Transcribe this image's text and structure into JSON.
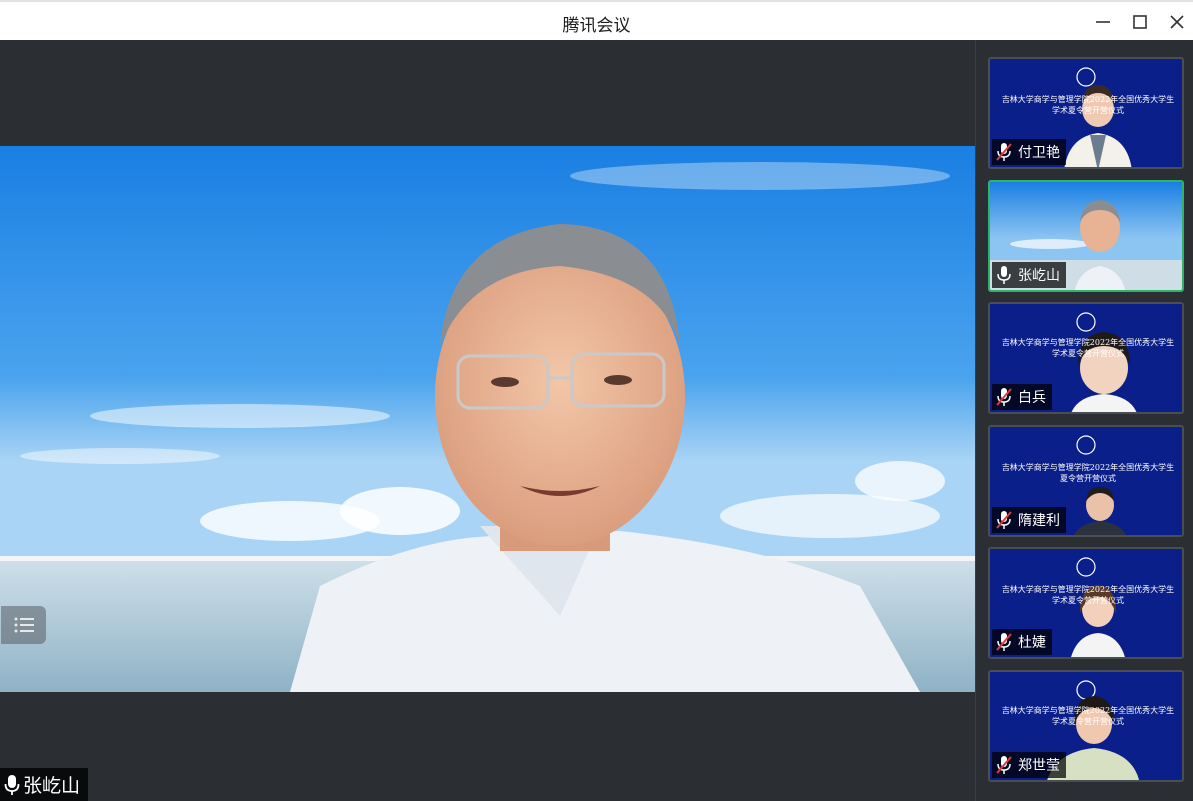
{
  "window": {
    "title": "腾讯会议",
    "minimize_icon": "minimize-icon",
    "maximize_icon": "maximize-icon",
    "close_icon": "close-icon"
  },
  "main_speaker": {
    "name": "张屹山",
    "mic_icon": "microphone-icon",
    "list_toggle_icon": "list-icon"
  },
  "banner": {
    "line1": "吉林大学商学与管理学院2022年全国优秀大学生",
    "line2": "学术夏令营开营仪式",
    "line2_alt": "夏令营开营仪式"
  },
  "participants": [
    {
      "name": "付卫艳",
      "mic": "mic-muted-icon",
      "background": "banner"
    },
    {
      "name": "张屹山",
      "mic": "microphone-icon",
      "background": "sky",
      "active": true
    },
    {
      "name": "白兵",
      "mic": "mic-muted-icon",
      "background": "banner"
    },
    {
      "name": "隋建利",
      "mic": "mic-muted-icon",
      "background": "banner"
    },
    {
      "name": "杜婕",
      "mic": "mic-muted-icon",
      "background": "banner"
    },
    {
      "name": "郑世莹",
      "mic": "mic-muted-icon",
      "background": "banner"
    }
  ],
  "colors": {
    "stage_bg": "#2b2e32",
    "active_border": "#2fb36a",
    "banner_blue": "#0b1f8a",
    "muted_red": "#e23b3b"
  }
}
